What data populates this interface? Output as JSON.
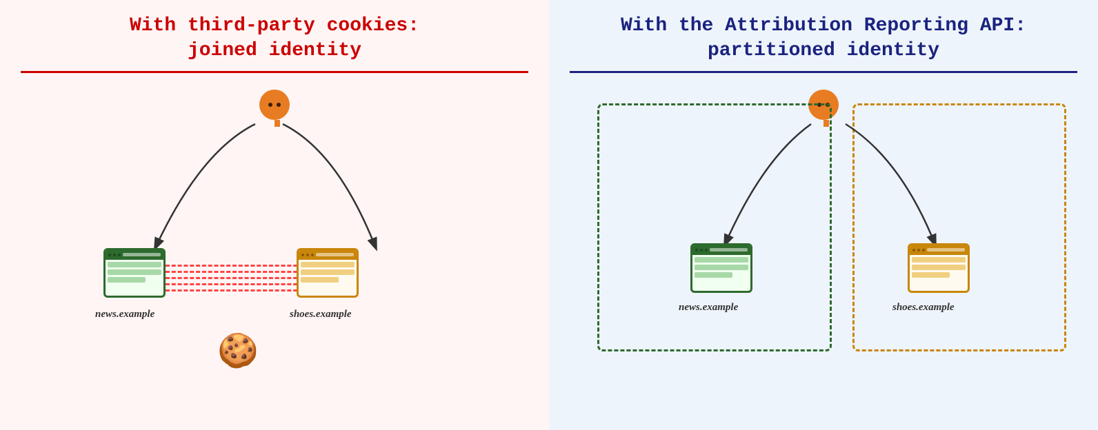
{
  "left_panel": {
    "title_line1": "With third-party cookies:",
    "title_line2": "joined identity",
    "news_label": "news.example",
    "shoes_label": "shoes.example"
  },
  "right_panel": {
    "title_line1": "With the Attribution Reporting API:",
    "title_line2": "partitioned identity",
    "news_label": "news.example",
    "shoes_label": "shoes.example"
  }
}
